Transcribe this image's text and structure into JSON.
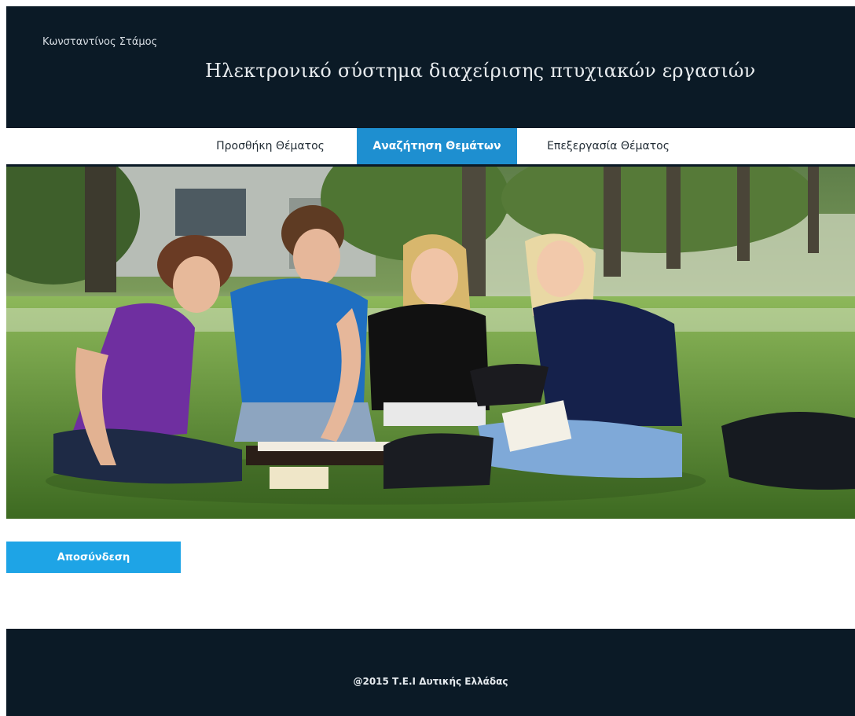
{
  "header": {
    "user_name": "Κωνσταντίνος Στάμος",
    "title": "Ηλεκτρονικό σύστημα διαχείρισης πτυχιακών εργασιών"
  },
  "nav": {
    "items": [
      {
        "label": "Προσθήκη Θέματος",
        "active": false
      },
      {
        "label": "Αναζήτηση Θεμάτων",
        "active": true
      },
      {
        "label": "Επεξεργασία Θέματος",
        "active": false
      }
    ]
  },
  "actions": {
    "logout_label": "Αποσύνδεση"
  },
  "footer": {
    "copyright": "@2015 Τ.Ε.Ι Δυτικής Ελλάδας"
  },
  "colors": {
    "header_bg": "#0b1a26",
    "nav_active": "#1e8fd0",
    "button_bg": "#1ea4e6"
  }
}
